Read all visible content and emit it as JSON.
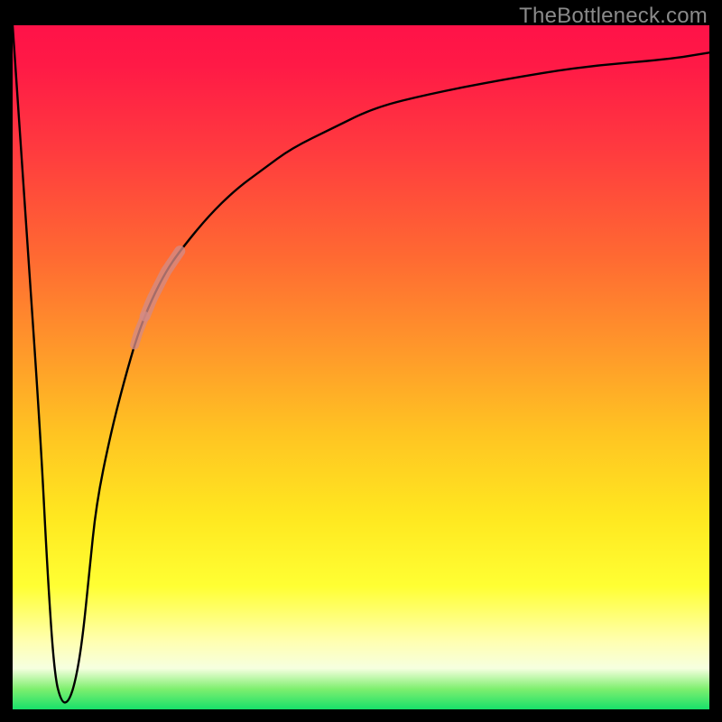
{
  "attribution": {
    "text": "TheBottleneck.com"
  },
  "colors": {
    "page_bg": "#000000",
    "curve": "#000000",
    "highlight": "#d48a85",
    "text": "#8a8a8a",
    "gradient_stops": [
      "#ff1248",
      "#ff1a46",
      "#ff3a3f",
      "#ff6a32",
      "#ff9a2a",
      "#ffc522",
      "#ffe820",
      "#ffff33",
      "#ffffb0",
      "#f6ffe0",
      "#7fef6f",
      "#18e06a"
    ]
  },
  "chart_data": {
    "type": "line",
    "title": "",
    "xlabel": "",
    "ylabel": "",
    "xlim": [
      0,
      100
    ],
    "ylim": [
      0,
      100
    ],
    "axes_visible": false,
    "grid": false,
    "series": [
      {
        "name": "bottleneck-curve",
        "x": [
          0,
          2,
          4,
          5,
          6,
          7,
          8,
          9,
          10,
          11,
          12,
          14,
          16,
          18,
          20,
          22,
          24,
          28,
          32,
          36,
          40,
          46,
          52,
          60,
          70,
          82,
          94,
          100
        ],
        "y": [
          100,
          70,
          40,
          20,
          5,
          1,
          1,
          4,
          10,
          20,
          30,
          40,
          48,
          55,
          60,
          64,
          67,
          72,
          76,
          79,
          82,
          85,
          88,
          90,
          92,
          94,
          95,
          96
        ]
      }
    ],
    "highlighted_ranges": [
      {
        "name": "upper-segment",
        "x_start": 19,
        "x_end": 24,
        "along_series": "bottleneck-curve"
      },
      {
        "name": "lower-dot",
        "x_start": 17.5,
        "x_end": 19,
        "along_series": "bottleneck-curve"
      }
    ],
    "background_gradient": {
      "direction": "top-to-bottom",
      "meaning": "red-high-to-green-low"
    }
  }
}
